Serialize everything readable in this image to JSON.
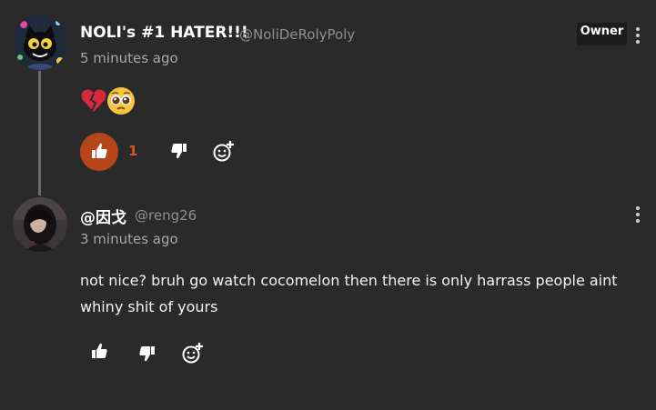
{
  "comments": [
    {
      "username": "NOLI's #1 HATER!!!",
      "handle": "@NoliDeRolyPoly",
      "timestamp": "5 minutes ago",
      "badge": "Owner",
      "emojis": [
        "broken-heart",
        "pleading-face"
      ],
      "like_count": "1",
      "liked": true,
      "avatar_icon": "cartoon-cat-avatar"
    },
    {
      "username": "@因戈",
      "handle": "@reng26",
      "timestamp": "3 minutes ago",
      "text": "not nice? bruh go watch cocomelon then there is only harrass people aint whiny shit of yours",
      "liked": false,
      "avatar_icon": "photo-avatar"
    }
  ],
  "icons": {
    "like": "thumbs-up-icon",
    "dislike": "thumbs-down-icon",
    "react": "add-reaction-icon",
    "more": "more-options-icon"
  },
  "colors": {
    "background": "#2a2a2b",
    "like_active": "#b5461a",
    "like_count": "#d9571c",
    "thread_line": "#6b6b6e"
  }
}
